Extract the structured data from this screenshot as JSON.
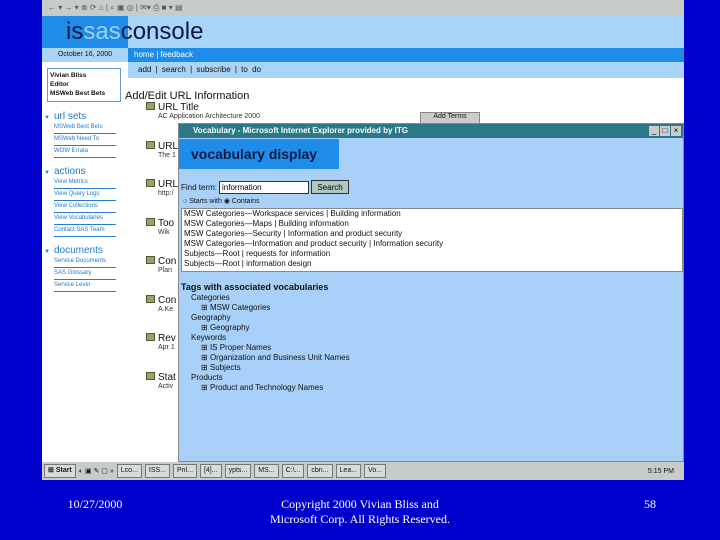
{
  "toolbar": {
    "icons": "← ▾ → ▾ ⊗ ⟳ ⌂ | ⌕ ▣ ◎ | ✉▾ ⎙ ■ ▾ ▤"
  },
  "header": {
    "logo_a": "is",
    "logo_b": "sas",
    "logo_c": "console",
    "date": "October 16, 2000",
    "home_links": "home | feedback",
    "nav": "add  |  search  | subscribe | to do"
  },
  "user": {
    "name": "Vivian Bliss",
    "role": "Editor",
    "site": "MSWeb Best Bets"
  },
  "sidebar": [
    {
      "title": "url sets",
      "items": [
        "MSWeb Best Bets",
        "MSWeb Need To",
        "WOW Errata"
      ]
    },
    {
      "title": "actions",
      "items": [
        "View Metrics",
        "View Query Logs",
        "View Collections",
        "View Vocabularies",
        "Contact SAS Team"
      ]
    },
    {
      "title": "documents",
      "items": [
        "Service Documents",
        "SAS Glossary",
        "Service Level"
      ]
    }
  ],
  "main": {
    "title": "Add/Edit URL Information",
    "fields": [
      {
        "label": "URL Title",
        "sub": "AC Application Architecture 2000"
      },
      {
        "label": "URL",
        "sub": "The 1"
      },
      {
        "label": "URL",
        "sub": "http:/"
      },
      {
        "label": "Too",
        "sub": "Wik"
      },
      {
        "label": "Con",
        "sub": "Plan"
      },
      {
        "label": "Con",
        "sub": "A.Ke"
      },
      {
        "label": "Rev",
        "sub": "Apr 1"
      },
      {
        "label": "Stat",
        "sub": "Activ"
      }
    ],
    "add_terms": "Add Terms"
  },
  "popup": {
    "title": "Vocabulary - Microsoft Internet Explorer provided by ITG",
    "heading": "vocabulary display",
    "find_label": "Find term:",
    "find_value": "information",
    "search_btn": "Search",
    "radio1": "Starts with",
    "radio2": "Contains",
    "results": [
      "MSW Categories—Workspace services | Building information",
      "MSW Categories—Maps | Building information",
      "MSW Categories—Security | Information and product security",
      "MSW Categories—Information and product security | Information security",
      "Subjects—Root | requests for information",
      "Subjects—Root | information design"
    ],
    "tags_title": "Tags with associated vocabularies",
    "tags": [
      {
        "group": "Categories",
        "items": [
          "MSW Categories"
        ]
      },
      {
        "group": "Geography",
        "items": [
          "Geography"
        ]
      },
      {
        "group": "Keywords",
        "items": [
          "IS Proper Names",
          "Organization and Business Unit Names",
          "Subjects"
        ]
      },
      {
        "group": "Products",
        "items": [
          "Product and Technology Names"
        ]
      }
    ]
  },
  "taskbar": {
    "start": "Start",
    "items": [
      "Lco...",
      "ISS...",
      "Pnl...",
      "[4]...",
      "ypts...",
      "MS...",
      "C:\\...",
      "cbn...",
      "Lea...",
      "Vo..."
    ],
    "clock": "5:15 PM"
  },
  "footer": {
    "date": "10/27/2000",
    "copyright1": "Copyright 2000 Vivian Bliss and",
    "copyright2": "Microsoft Corp. All Rights Reserved.",
    "page": "58"
  }
}
